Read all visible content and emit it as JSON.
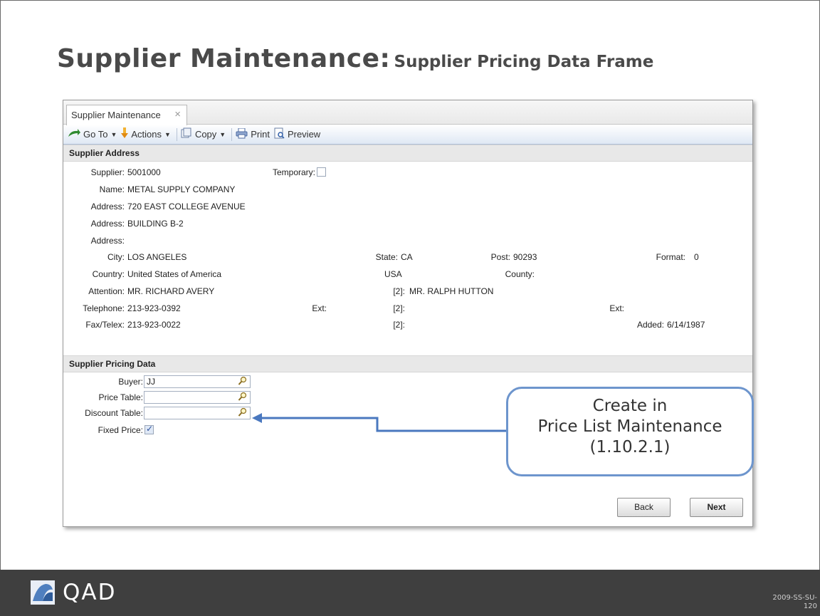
{
  "slide": {
    "title_main": "Supplier Maintenance:",
    "title_sub": "Supplier Pricing Data Frame",
    "code": "2009-SS-SU-",
    "page": "120",
    "logo_text": "QAD"
  },
  "tab": {
    "label": "Supplier Maintenance",
    "close": "×"
  },
  "toolbar": {
    "goto": "Go To",
    "actions": "Actions",
    "copy": "Copy",
    "print": "Print",
    "preview": "Preview"
  },
  "address_section": {
    "header": "Supplier Address",
    "supplier_label": "Supplier:",
    "supplier": "5001000",
    "temporary_label": "Temporary:",
    "name_label": "Name:",
    "name": "METAL SUPPLY COMPANY",
    "address_label": "Address:",
    "address1": "720 EAST COLLEGE AVENUE",
    "address2": "BUILDING B-2",
    "address3": "",
    "city_label": "City:",
    "city": "LOS ANGELES",
    "state_label": "State:",
    "state": "CA",
    "post_label": "Post:",
    "post": "90293",
    "format_label": "Format:",
    "format": "0",
    "country_label": "Country:",
    "country": "United States of America",
    "country_code": "USA",
    "county_label": "County:",
    "attention_label": "Attention:",
    "attention": "MR. RICHARD AVERY",
    "attention2_label": "[2]:",
    "attention2": "MR. RALPH HUTTON",
    "telephone_label": "Telephone:",
    "telephone": "213-923-0392",
    "ext_label": "Ext:",
    "tel2_label": "[2]:",
    "ext2_label": "Ext:",
    "fax_label": "Fax/Telex:",
    "fax": "213-923-0022",
    "fax2_label": "[2]:",
    "added_label": "Added:",
    "added": "6/14/1987"
  },
  "pricing_section": {
    "header": "Supplier Pricing Data",
    "buyer_label": "Buyer:",
    "buyer": "JJ",
    "price_table_label": "Price Table:",
    "price_table": "",
    "discount_table_label": "Discount Table:",
    "discount_table": "",
    "fixed_price_label": "Fixed Price:"
  },
  "buttons": {
    "back": "Back",
    "next": "Next"
  },
  "callout": {
    "line1": "Create in",
    "line2": "Price List Maintenance",
    "line3": "(1.10.2.1)"
  },
  "colors": {
    "callout_border": "#6d95cd",
    "footer": "#3f3f3f",
    "title": "#4a4a4a"
  }
}
